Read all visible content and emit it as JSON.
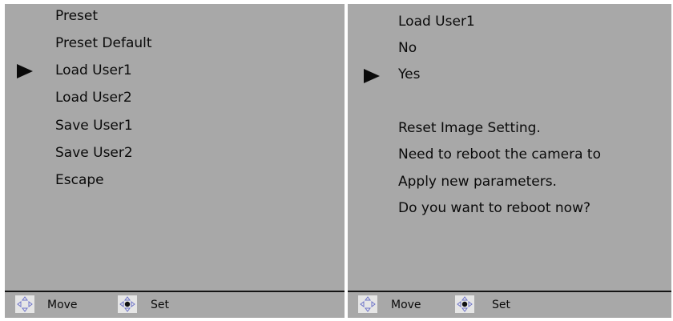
{
  "left_panel": {
    "items": [
      {
        "label": "Preset"
      },
      {
        "label": "Preset Default"
      },
      {
        "label": "Load User1"
      },
      {
        "label": "Load User2"
      },
      {
        "label": "Save User1"
      },
      {
        "label": "Save User2"
      },
      {
        "label": "Escape"
      }
    ],
    "selected_item": "Load User1",
    "footer": {
      "move_label": "Move",
      "set_label": "Set"
    }
  },
  "right_panel": {
    "title": "Load User1",
    "options": [
      {
        "label": "No"
      },
      {
        "label": "Yes"
      }
    ],
    "selected_option": "Yes",
    "message_lines": [
      "Reset Image Setting.",
      "Need to reboot the camera to",
      "Apply new parameters.",
      "Do you want to reboot now?"
    ],
    "footer": {
      "move_label": "Move",
      "set_label": "Set"
    }
  },
  "icons": {
    "pointer": "triangle-right-icon",
    "move": "direction-pad-move-icon",
    "set": "direction-pad-set-icon"
  },
  "colors": {
    "screen_background": "#a8a8a8",
    "text": "#0a0a0a",
    "pad_background": "#e6e6e6",
    "pad_arrow": "#6e74c9"
  }
}
